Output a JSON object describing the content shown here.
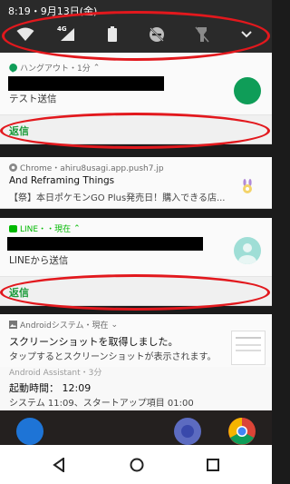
{
  "status_bar": {
    "time_date": "8:19・9月13日(金)"
  },
  "quick_settings": {
    "icons": [
      "wifi-icon",
      "signal-icon",
      "battery-icon",
      "do-not-disturb-icon",
      "flashlight-off-icon",
      "expand-icon"
    ],
    "signal_label": "4G"
  },
  "notifications": [
    {
      "app": "ハングアウト・1分",
      "body": "テスト送信",
      "action": "返信"
    },
    {
      "app": "Chrome・ahiru8usagi.app.push7.jp",
      "title": "And Reframing Things",
      "body": "【祭】本日ポケモンGO Plus発売日！購入できる店..."
    },
    {
      "app": "LINE・・現在",
      "body": "LINEから送信",
      "action": "返信"
    },
    {
      "app": "Androidシステム・現在",
      "title": "スクリーンショットを取得しました。",
      "body": "タップするとスクリーンショットが表示されます。"
    },
    {
      "app": "Android Assistant・3分",
      "title": "起動時間： 12:09",
      "body": "システム 11:09、スタートアップ項目 01:00"
    }
  ],
  "colors": {
    "annotation": "#e2181d",
    "reply": "#1a9b3a",
    "hangouts": "#0f9d58",
    "line": "#00b900"
  }
}
